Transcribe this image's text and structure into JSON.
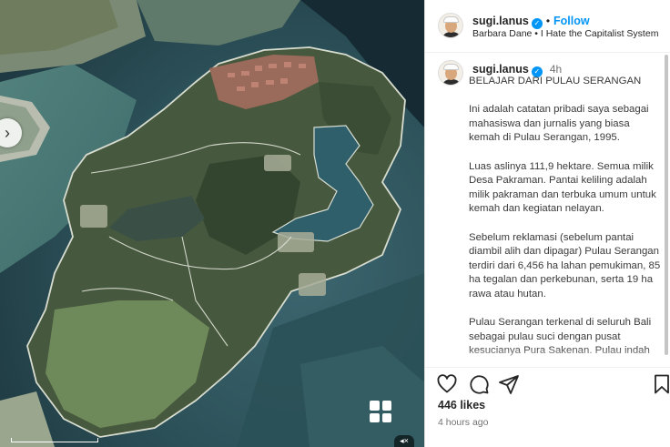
{
  "post": {
    "username": "sugi.lanus",
    "verified_icon": "check-icon",
    "follow_label": "Follow",
    "audio_text": "Barbara Dane • I Hate the Capitalist System",
    "caption_time": "4h",
    "caption_title": "BELAJAR DARI PULAU SERANGAN",
    "caption_paragraphs": [
      "Ini adalah catatan pribadi saya sebagai mahasiswa dan jurnalis yang biasa kemah di Pulau Serangan, 1995.",
      "Luas aslinya 111,9 hektare. Semua milik Desa Pakraman. Pantai keliling adalah milik pakraman dan terbuka umum untuk kemah dan kegiatan nelayan.",
      "Sebelum reklamasi (sebelum pantai diambil alih dan dipagar) Pulau Serangan terdiri dari 6,456 ha lahan pemukiman, 85 ha tegalan dan perkebunan, serta 19 ha rawa atau hutan.",
      "Pulau Serangan terkenal di seluruh Bali sebagai pulau suci dengan pusat kesucianya Pura Sakenan. Pulau indah"
    ],
    "likes": "446 likes",
    "posted_time": "4 hours ago"
  },
  "media": {
    "prev_icon": "chevron-left-icon",
    "gallery_icon": "grid-icon",
    "mute_icon": "speaker-muted-icon"
  },
  "actions": {
    "icons": [
      "heart-icon",
      "comment-icon",
      "share-icon",
      "bookmark-icon"
    ]
  },
  "colors": {
    "accent": "#0095f6",
    "text": "#262626",
    "muted": "#737373"
  }
}
